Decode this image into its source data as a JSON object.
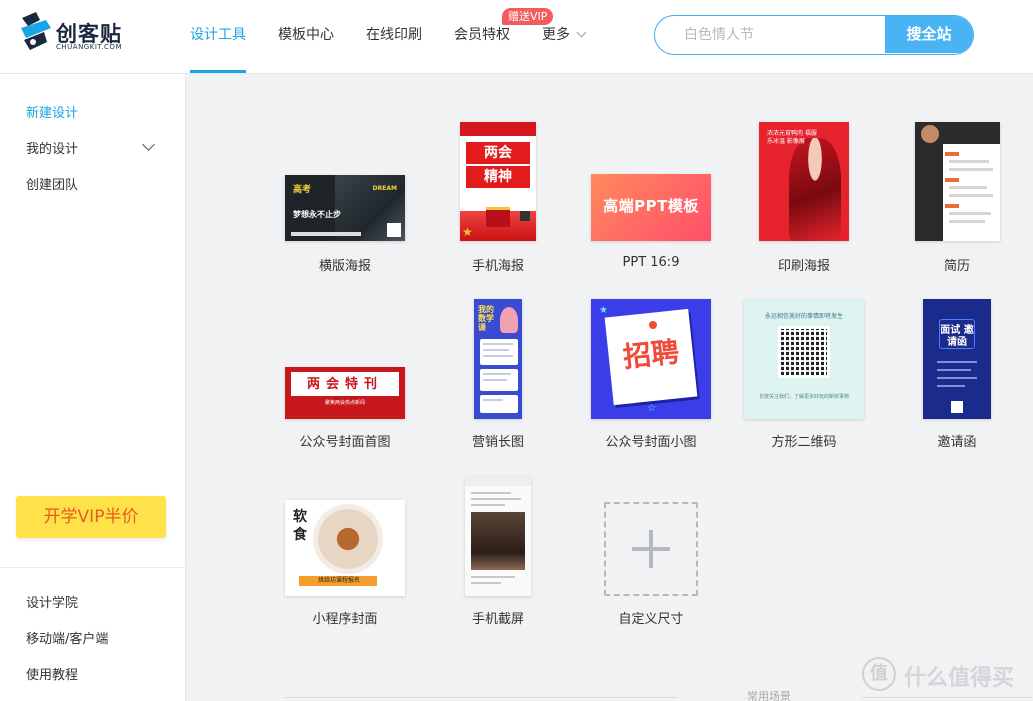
{
  "brand": {
    "name": "创客贴",
    "sub": "CHUANGKIT.COM",
    "accent": "#1ba4e6"
  },
  "nav": {
    "items": [
      {
        "label": "设计工具",
        "active": true
      },
      {
        "label": "模板中心"
      },
      {
        "label": "在线印刷"
      },
      {
        "label": "会员特权"
      },
      {
        "label": "更多"
      }
    ],
    "vip_badge": "赠送VIP"
  },
  "search": {
    "placeholder": "白色情人节",
    "button": "搜全站"
  },
  "sidebar": {
    "top_items": [
      {
        "label": "新建设计",
        "active": true
      },
      {
        "label": "我的设计"
      },
      {
        "label": "创建团队"
      }
    ],
    "vip_banner": "开学VIP半价",
    "bottom_items": [
      {
        "label": "设计学院"
      },
      {
        "label": "移动端/客户端"
      },
      {
        "label": "使用教程"
      }
    ]
  },
  "templates": [
    {
      "label": "横版海报",
      "thumb": {
        "title1": "高考",
        "title2": "梦想永不止步",
        "badge": "DREAM"
      }
    },
    {
      "label": "手机海报",
      "thumb": {
        "text1": "两会",
        "text2": "精神"
      }
    },
    {
      "label": "PPT 16:9",
      "thumb": {
        "text": "高端PPT模板"
      }
    },
    {
      "label": "印刷海报",
      "thumb": {
        "text": "浓浓元宵鸭肉 福服乐冰温 影像展"
      }
    },
    {
      "label": "简历",
      "thumb": {}
    },
    {
      "label": "公众号封面首图",
      "thumb": {
        "text": "两会特刊",
        "sub": "聚焦两会热点新闻"
      }
    },
    {
      "label": "营销长图",
      "thumb": {
        "text": "我的 数学课"
      }
    },
    {
      "label": "公众号封面小图",
      "thumb": {
        "text": "招聘"
      }
    },
    {
      "label": "方形二维码",
      "thumb": {
        "head": "永远相信美好的事情即将发生",
        "foot": "长按关注我们，了解更多好玩的新鲜事物"
      }
    },
    {
      "label": "邀请函",
      "thumb": {
        "text": "面试 邀请函"
      }
    },
    {
      "label": "小程序封面",
      "thumb": {
        "chars": "软食",
        "bar": "烘焙坊课程报名"
      }
    },
    {
      "label": "手机截屏",
      "thumb": {}
    },
    {
      "label": "自定义尺寸"
    }
  ],
  "section_label": "常用场景",
  "watermark": {
    "circle": "值",
    "text": "什么值得买"
  }
}
